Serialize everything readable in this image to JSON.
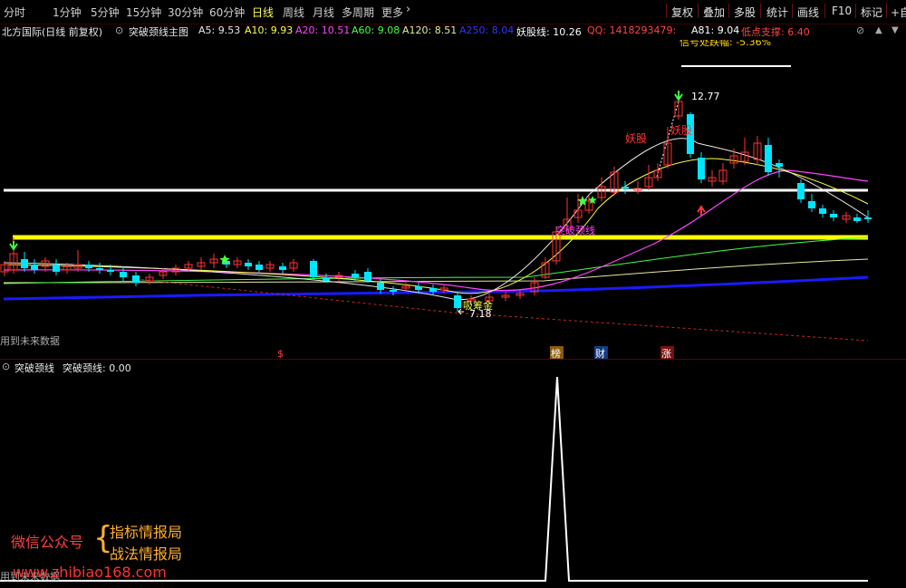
{
  "toolbar": {
    "periods": [
      "分时",
      "1分钟",
      "5分钟",
      "15分钟",
      "30分钟",
      "60分钟",
      "日线",
      "周线",
      "月线",
      "多周期",
      "更多"
    ],
    "active_period": "日线",
    "more_arrow": "›",
    "right_buttons": [
      "复权",
      "叠加",
      "多股",
      "统计",
      "画线",
      "F10",
      "标记",
      "+自"
    ]
  },
  "header": {
    "stock": "北方国际(日线 前复权)",
    "indicator_toggle": "⊙",
    "indicator_name": "突破颈线主图",
    "ma": [
      {
        "label": "A5: 9.53",
        "color": "#e8e8e8"
      },
      {
        "label": "A10: 9.93",
        "color": "#ffff44"
      },
      {
        "label": "A20: 10.51",
        "color": "#ff44ff"
      },
      {
        "label": "A60: 9.08",
        "color": "#44ff44"
      },
      {
        "label": "A120: 8.51",
        "color": "#e8e8a0"
      },
      {
        "label": "A250: 8.04",
        "color": "#3333ff"
      }
    ],
    "yao": {
      "label": "妖股线: 10.26",
      "color": "#ffffff"
    },
    "qq": {
      "label": "QQ: 1418293479:",
      "color": "#ff4444"
    },
    "a81": {
      "label": "A81: 9.04",
      "color": "#ffffff"
    },
    "low": {
      "label": "低点支撑: 6.40",
      "color": "#ff4444"
    },
    "window_controls": [
      "⊘",
      "▲",
      "▼"
    ]
  },
  "main_chart": {
    "partial_top_text": "信号处跌幅: -5.36%",
    "peak_label": "12.77",
    "low_label": "7.18",
    "yao_label_1": "妖股",
    "yao_label_2": "妖股",
    "breakout_label": "突破颈线",
    "gold_label": "吸筹金",
    "future_note": "用到未来数据",
    "markers": [
      {
        "text": "$",
        "bg": "#000000",
        "color": "#ff4444"
      },
      {
        "text": "榜",
        "bg": "#8a5a10",
        "color": "#ffffff"
      },
      {
        "text": "财",
        "bg": "#153a80",
        "color": "#ffffff"
      },
      {
        "text": "涨",
        "bg": "#7a1010",
        "color": "#ffffff"
      }
    ],
    "colors": {
      "up": "#ff3333",
      "down": "#00e5ff",
      "white_line": "#ffffff",
      "yellow_line": "#ffff00",
      "blue_line": "#1a1aff"
    }
  },
  "sub_chart": {
    "title": "突破颈线",
    "value": "突破颈线: 0.00",
    "future_note": "用到未来数据"
  },
  "watermark": {
    "left": "微信公众号",
    "brace": "{",
    "line1": "指标情报局",
    "line2": "战法情报局",
    "url": "www.zhibiao168.com"
  }
}
